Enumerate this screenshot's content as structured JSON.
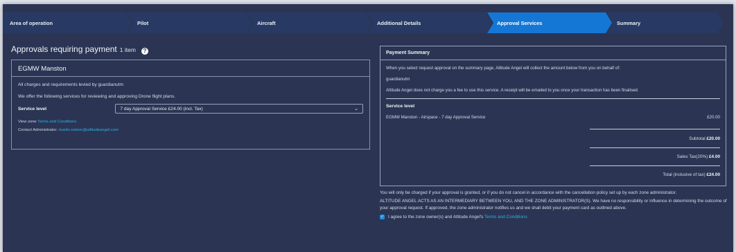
{
  "stepper": {
    "steps": [
      {
        "label": "Area of operation"
      },
      {
        "label": "Pilot"
      },
      {
        "label": "Aircraft"
      },
      {
        "label": "Additional Details"
      },
      {
        "label": "Approval Services"
      },
      {
        "label": "Summary"
      }
    ],
    "active_index": 4,
    "active_color": "#1477d6",
    "inactive_color": "#283a63"
  },
  "approvals": {
    "title": "Approvals requiring payment",
    "count": "1 item",
    "help_icon": "question-circle-icon",
    "zone": {
      "name": "EGMW Manston",
      "charges_text": "All charges and requirements levied by guardianutm",
      "offer_text": "We offer the following services for reviewing and approving Drone flight plans.",
      "service_level_label": "Service level",
      "service_level_value": "7 day Approval Service £24.00 (incl. Tax)",
      "view_zone_prefix": "View zone",
      "terms_link": "Terms and Conditions",
      "contact_prefix": "Contact Administrator:",
      "contact_email": "martin.nelson@altitudeangel.com"
    }
  },
  "payment_summary": {
    "title": "Payment Summary",
    "intro": "When you select request approval on the summary page, Altitude Angel will collect the amount below from you on behalf of:",
    "payee": "guardianutm",
    "fee_note": "Altitude Angel does not charge you a fee to use this service. A receipt will be emailed to you once your transaction has been finalised.",
    "service_level_heading": "Service level",
    "item_name": "EGMW Manston - Airspace - 7 day Approval Service",
    "item_price": "£20.00",
    "subtotal_label": "Subtotal",
    "subtotal_value": "£20.00",
    "tax_label": "Sales Tax(20%)",
    "tax_value": "£4.00",
    "total_label": "Total (inclusive of tax)",
    "total_value": "£24.00"
  },
  "notes": {
    "charge_note": "You will only be charged if your approval is granted, or if you do not cancel in accordance with the cancellation policy set up by each zone administrator.",
    "intermediary_note": "ALTITUDE ANGEL ACTS AS AN INTERMEDIARY BETWEEN YOU, AND THE ZONE ADMINISTRATOR(S). We have no responsibility or influence in determining the outcome of your approval request. If approved, the zone administrator notifies us and we shall debit your payment card as outlined above.",
    "agree_prefix": "I agree to the zone owner(s) and Altitude Angel's",
    "agree_link": "Terms and Conditions",
    "agree_checked": true
  }
}
